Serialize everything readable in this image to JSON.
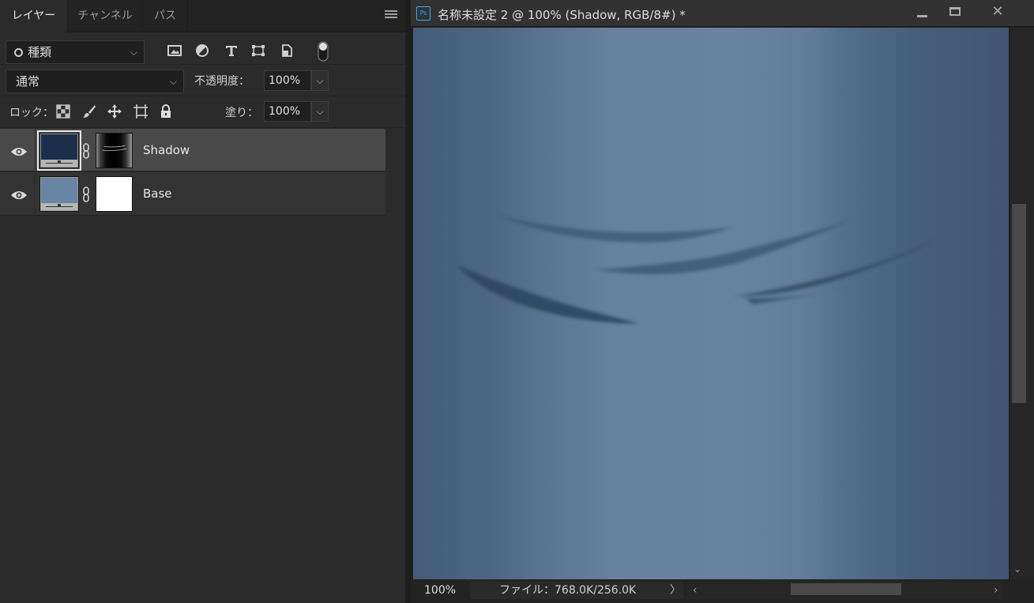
{
  "layers_panel": {
    "tabs": [
      {
        "label": "レイヤー",
        "active": true
      },
      {
        "label": "チャンネル",
        "active": false
      },
      {
        "label": "パス",
        "active": false
      }
    ],
    "menu_icon": "hamburger-menu-icon",
    "filter": {
      "kind_label": "種類",
      "icons": [
        "image-filter-icon",
        "adjustment-filter-icon",
        "type-filter-icon",
        "shape-filter-icon",
        "smart-object-filter-icon",
        "filter-toggle-icon"
      ]
    },
    "blend": {
      "mode": "通常",
      "opacity_label": "不透明度：",
      "opacity_value": "100%"
    },
    "lock": {
      "label": "ロック：",
      "icons": [
        "lock-transparent-pixels-icon",
        "lock-image-pixels-icon",
        "lock-position-icon",
        "lock-artboard-icon",
        "lock-all-icon"
      ],
      "fill_label": "塗り：",
      "fill_value": "100%"
    },
    "layers": [
      {
        "name": "Shadow",
        "selected": true,
        "visible": true,
        "thumb_color": "#1b2f4a",
        "mask": "gradient"
      },
      {
        "name": "Base",
        "selected": false,
        "visible": true,
        "thumb_color": "#6885a4",
        "mask": "white"
      }
    ]
  },
  "document": {
    "title": "名称未設定 2 @ 100% (Shadow, RGB/8#) *",
    "app_icon_text": "Ps",
    "zoom": "100%",
    "file_info": "ファイル：768.0K/256.0K",
    "status_arrow": "〉",
    "scroll_left": "‹",
    "scroll_right": "›",
    "scroll_down": "⌄",
    "close_glyph": "✕"
  },
  "colors": {
    "panel_bg": "#2b2b2b",
    "selected_layer_bg": "#494949",
    "canvas_base": "#6783a0",
    "shadow_stroke": "#3e5670",
    "accent": "#31a8ff"
  }
}
